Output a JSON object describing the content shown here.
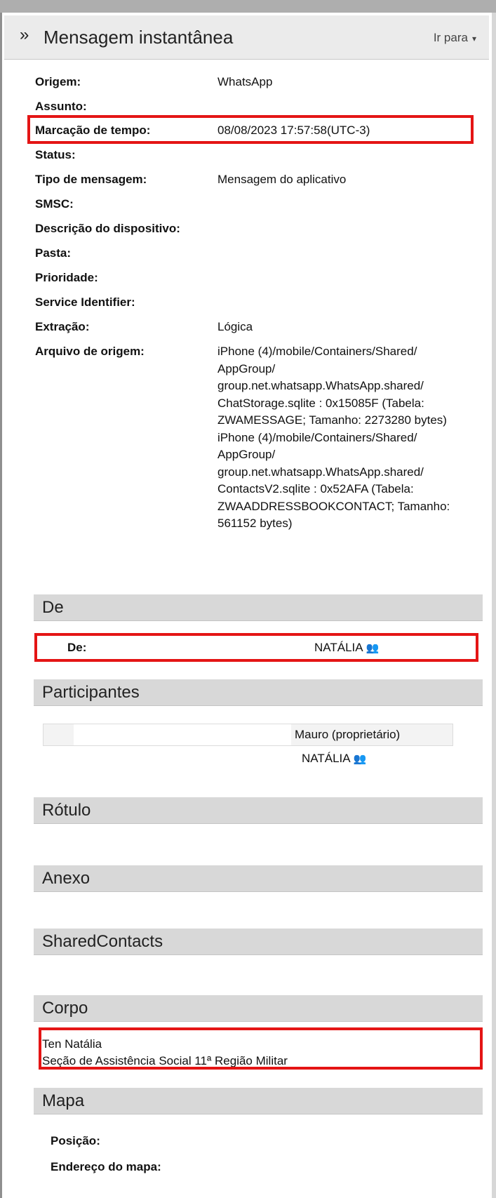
{
  "header": {
    "chevron_glyph": "»",
    "title": "Mensagem instantânea",
    "goto_label": "Ir para",
    "caret_glyph": "▾"
  },
  "fields": {
    "origem": {
      "label": "Origem:",
      "value": "WhatsApp"
    },
    "assunto": {
      "label": "Assunto:",
      "value": ""
    },
    "marcacao": {
      "label": "Marcação de tempo:",
      "value": "08/08/2023 17:57:58(UTC-3)"
    },
    "status": {
      "label": "Status:",
      "value": ""
    },
    "tipo": {
      "label": "Tipo de mensagem:",
      "value": "Mensagem do aplicativo"
    },
    "smsc": {
      "label": "SMSC:",
      "value": ""
    },
    "descricao": {
      "label": "Descrição do dispositivo:",
      "value": ""
    },
    "pasta": {
      "label": "Pasta:",
      "value": ""
    },
    "prioridade": {
      "label": "Prioridade:",
      "value": ""
    },
    "service": {
      "label": "Service Identifier:",
      "value": ""
    },
    "extracao": {
      "label": "Extração:",
      "value": "Lógica"
    },
    "arquivo": {
      "label": "Arquivo de origem:",
      "lines": [
        "iPhone (4)/mobile/Containers/Shared/",
        "AppGroup/",
        "group.net.whatsapp.WhatsApp.shared/",
        "ChatStorage.sqlite : 0x15085F (Tabela:",
        "ZWAMESSAGE; Tamanho: 2273280 bytes)",
        "iPhone (4)/mobile/Containers/Shared/",
        "AppGroup/",
        "group.net.whatsapp.WhatsApp.shared/",
        "ContactsV2.sqlite : 0x52AFA (Tabela:",
        "ZWAADDRESSBOOKCONTACT; Tamanho:",
        "561152 bytes)"
      ]
    }
  },
  "sections": {
    "de": {
      "title": "De",
      "label": "De:",
      "value": "NATÁLIA",
      "icon": "contact-avatar-icon"
    },
    "participantes": {
      "title": "Participantes",
      "owner": "Mauro (proprietário)",
      "other": "NATÁLIA",
      "icon": "contact-avatar-icon"
    },
    "rotulo": {
      "title": "Rótulo"
    },
    "anexo": {
      "title": "Anexo"
    },
    "shared": {
      "title": "SharedContacts"
    },
    "corpo": {
      "title": "Corpo",
      "lines": [
        "Ten Natália",
        "Seção de Assistência Social 11ª Região Militar"
      ]
    },
    "mapa": {
      "title": "Mapa",
      "posicao_label": "Posição:",
      "endereco_label": "Endereço do mapa:"
    }
  },
  "colors": {
    "highlight": "#e41515",
    "section_header": "#d8d8d8",
    "title_bar": "#ebebeb"
  }
}
